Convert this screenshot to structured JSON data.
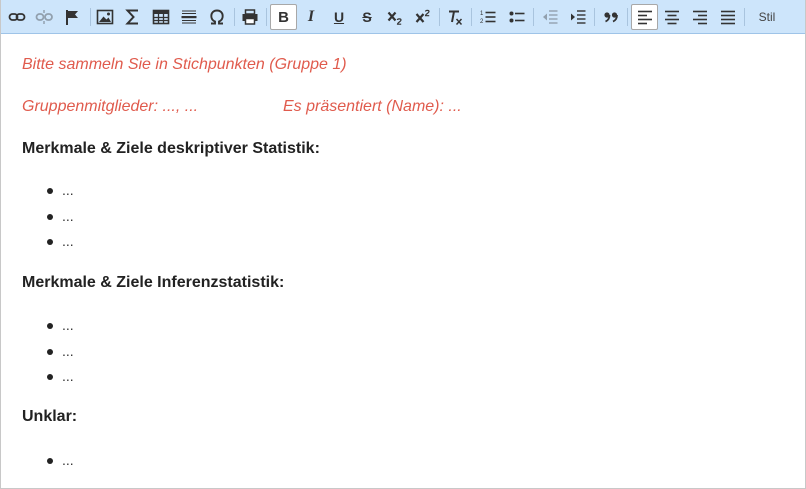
{
  "toolbar": {
    "bold_label": "B",
    "italic_label": "I",
    "underline_label": "U",
    "strike_label": "S",
    "style_label": "Stil",
    "icons": [
      "link-icon",
      "unlink-icon",
      "anchor-flag-icon",
      "image-icon",
      "sigma-icon",
      "table-icon",
      "horizontal-rule-icon",
      "omega-icon",
      "print-icon",
      "bold-icon",
      "italic-icon",
      "underline-icon",
      "strikethrough-icon",
      "subscript-icon",
      "superscript-icon",
      "remove-format-icon",
      "numbered-list-icon",
      "bulleted-list-icon",
      "outdent-icon",
      "indent-icon",
      "blockquote-icon",
      "align-left-icon",
      "align-center-icon",
      "align-right-icon",
      "align-justify-icon"
    ]
  },
  "content": {
    "intro": "Bitte sammeln Sie in Stichpunkten (Gruppe 1)",
    "members": "Gruppenmitglieder: ..., ...",
    "presenter": "Es präsentiert (Name): ...",
    "section1": {
      "heading": "Merkmale & Ziele deskriptiver Statistik:",
      "items": [
        "...",
        "...",
        "..."
      ]
    },
    "section2": {
      "heading": "Merkmale & Ziele Inferenzstatistik:",
      "items": [
        "...",
        "...",
        "..."
      ]
    },
    "section3": {
      "heading": "Unklar:",
      "items": [
        "..."
      ]
    }
  },
  "colors": {
    "toolbar_bg": "#cde5fb",
    "instruction_red": "#e05b4d",
    "text": "#222222"
  }
}
